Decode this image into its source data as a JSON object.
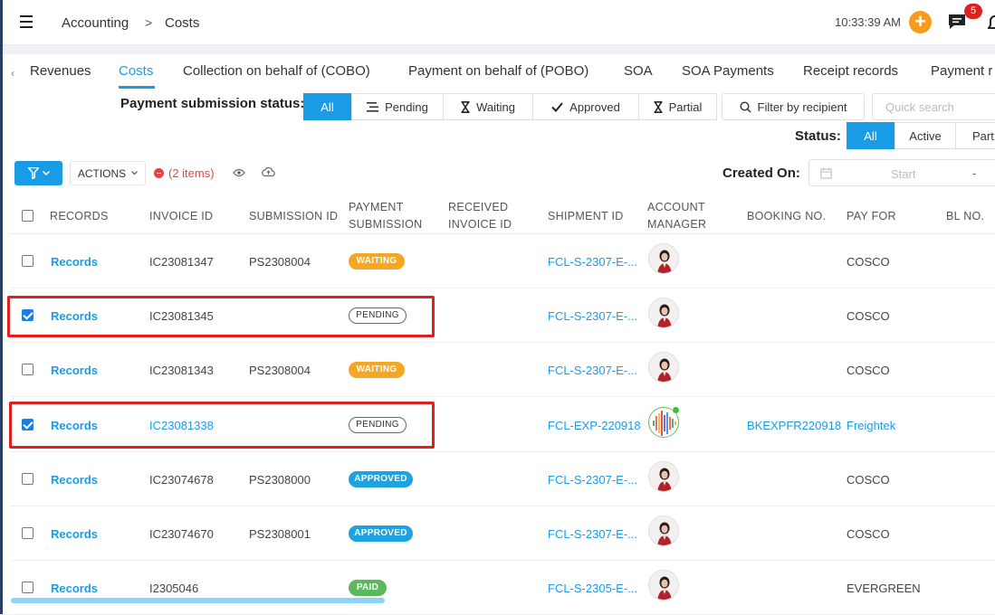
{
  "header": {
    "breadcrumb": [
      "Accounting",
      "Costs"
    ],
    "breadcrumb_separator": ">",
    "clock": "10:33:39 AM",
    "notification_count": "5"
  },
  "tabs": [
    {
      "label": "Revenues",
      "active": false
    },
    {
      "label": "Costs",
      "active": true
    },
    {
      "label": "Collection on behalf of (COBO)",
      "active": false
    },
    {
      "label": "Payment on behalf of (POBO)",
      "active": false
    },
    {
      "label": "SOA",
      "active": false
    },
    {
      "label": "SOA Payments",
      "active": false
    },
    {
      "label": "Receipt records",
      "active": false
    },
    {
      "label": "Payment r",
      "active": false
    }
  ],
  "filters": {
    "payment_status_label": "Payment submission status:",
    "payment_status_options": [
      "All",
      "Pending",
      "Waiting",
      "Approved",
      "Partial"
    ],
    "payment_status_selected": "All",
    "filter_by_recipient": "Filter by recipient",
    "quick_search_placeholder": "Quick search",
    "status_label": "Status:",
    "status_options": [
      "All",
      "Active",
      "Part"
    ],
    "status_selected": "All",
    "created_on_label": "Created On:",
    "date_start_placeholder": "Start",
    "date_separator": "-"
  },
  "toolbar": {
    "actions_label": "ACTIONS",
    "items_selected": "(2 items)"
  },
  "table": {
    "columns": {
      "records": "RECORDS",
      "invoice_id": "INVOICE ID",
      "submission_id": "SUBMISSION ID",
      "payment_submission_1": "PAYMENT",
      "payment_submission_2": "SUBMISSION",
      "received_invoice_1": "RECEIVED",
      "received_invoice_2": "INVOICE ID",
      "shipment_id": "SHIPMENT ID",
      "account_manager_1": "ACCOUNT",
      "account_manager_2": "MANAGER",
      "booking_no": "BOOKING NO.",
      "pay_for": "PAY FOR",
      "bl_no": "BL NO."
    },
    "rows": [
      {
        "checked": false,
        "records": "Records",
        "invoice_id": "IC23081347",
        "invoice_link": false,
        "submission_id": "PS2308004",
        "status": "WAITING",
        "status_kind": "waiting",
        "received_invoice_id": "",
        "shipment_id": "FCL-S-2307-E-...",
        "booking_no": "",
        "pay_for": "COSCO",
        "pay_for_link": false,
        "avatar": "person"
      },
      {
        "checked": true,
        "records": "Records",
        "invoice_id": "IC23081345",
        "invoice_link": false,
        "submission_id": "",
        "status": "PENDING",
        "status_kind": "pending",
        "received_invoice_id": "",
        "shipment_id": "FCL-S-2307-E-...",
        "booking_no": "",
        "pay_for": "COSCO",
        "pay_for_link": false,
        "avatar": "person"
      },
      {
        "checked": false,
        "records": "Records",
        "invoice_id": "IC23081343",
        "invoice_link": false,
        "submission_id": "PS2308004",
        "status": "WAITING",
        "status_kind": "waiting",
        "received_invoice_id": "",
        "shipment_id": "FCL-S-2307-E-...",
        "booking_no": "",
        "pay_for": "COSCO",
        "pay_for_link": false,
        "avatar": "person"
      },
      {
        "checked": true,
        "records": "Records",
        "invoice_id": "IC23081338",
        "invoice_link": true,
        "submission_id": "",
        "status": "PENDING",
        "status_kind": "pending",
        "received_invoice_id": "",
        "shipment_id": "FCL-EXP-220918",
        "booking_no": "BKEXPFR220918",
        "pay_for": "Freightek",
        "pay_for_link": true,
        "avatar": "waveform"
      },
      {
        "checked": false,
        "records": "Records",
        "invoice_id": "IC23074678",
        "invoice_link": false,
        "submission_id": "PS2308000",
        "status": "APPROVED",
        "status_kind": "approved",
        "received_invoice_id": "",
        "shipment_id": "FCL-S-2307-E-...",
        "booking_no": "",
        "pay_for": "COSCO",
        "pay_for_link": false,
        "avatar": "person"
      },
      {
        "checked": false,
        "records": "Records",
        "invoice_id": "IC23074670",
        "invoice_link": false,
        "submission_id": "PS2308001",
        "status": "APPROVED",
        "status_kind": "approved",
        "received_invoice_id": "",
        "shipment_id": "FCL-S-2307-E-...",
        "booking_no": "",
        "pay_for": "COSCO",
        "pay_for_link": false,
        "avatar": "person"
      },
      {
        "checked": false,
        "records": "Records",
        "invoice_id": "I2305046",
        "invoice_link": false,
        "submission_id": "",
        "status": "PAID",
        "status_kind": "paid",
        "received_invoice_id": "",
        "shipment_id": "FCL-S-2305-E-...",
        "booking_no": "",
        "pay_for": "EVERGREEN",
        "pay_for_link": false,
        "avatar": "person"
      }
    ]
  },
  "colors": {
    "accent": "#1a9be6",
    "waiting": "#f5a623",
    "approved": "#1fa2e0",
    "paid": "#5cb85c",
    "highlight": "#e01f1f",
    "add_button": "#f79b1c"
  }
}
